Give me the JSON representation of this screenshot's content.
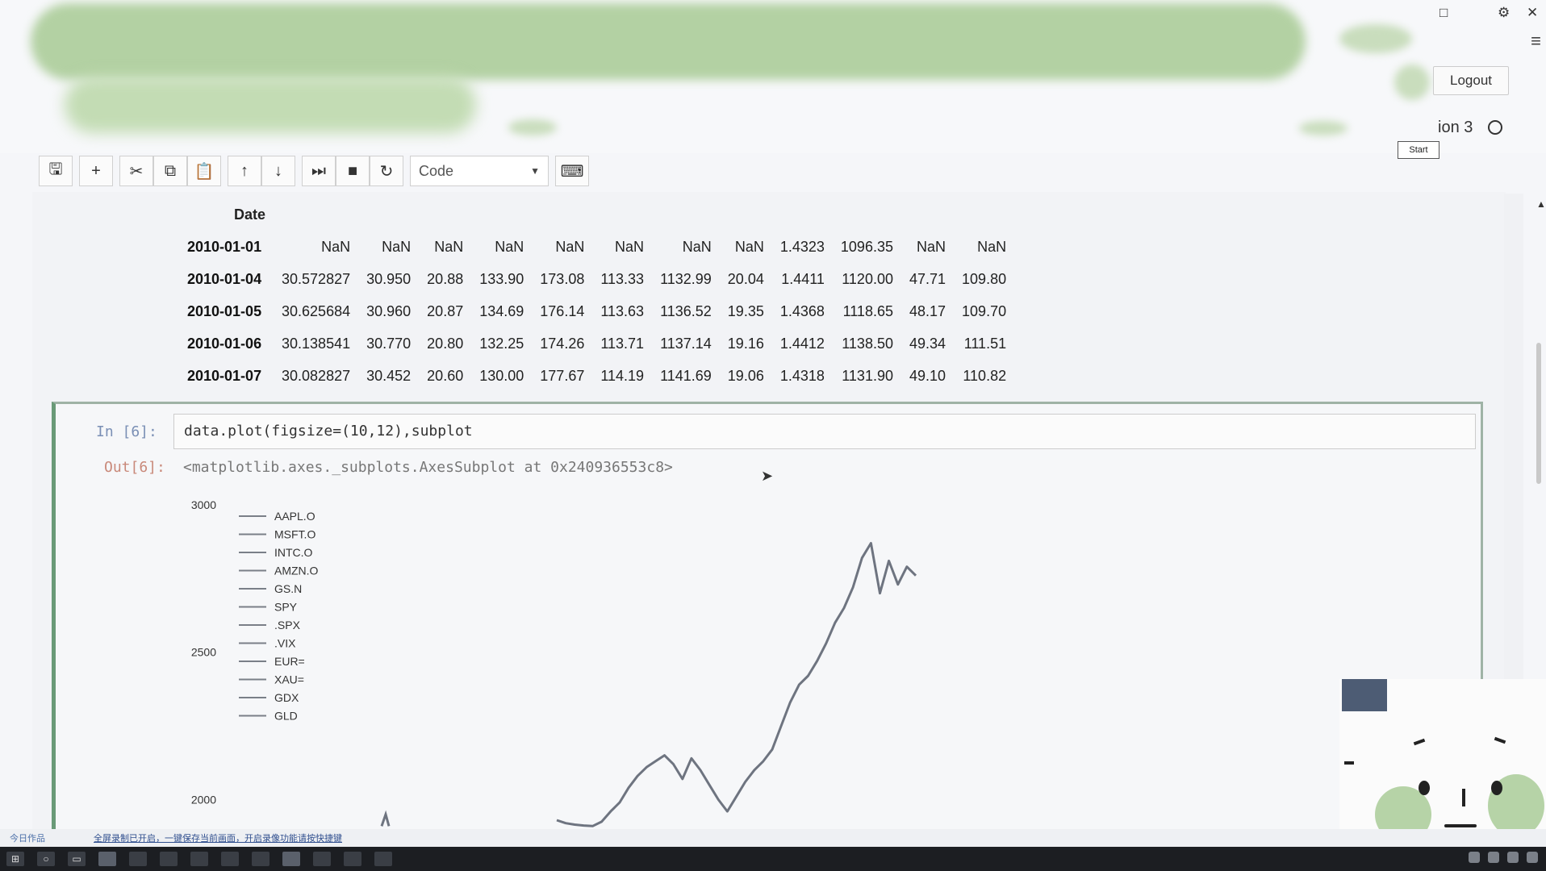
{
  "header": {
    "logout_label": "Logout",
    "kernel_name": "ion 3",
    "start_tip": "Start",
    "window_controls": [
      "□",
      "⚙",
      "✕"
    ],
    "menu_icon": "≡"
  },
  "toolbar": {
    "save": "🖫",
    "add": "+",
    "cut": "✂",
    "copy": "⧉",
    "paste": "📋",
    "move_up": "↑",
    "move_down": "↓",
    "run": "⏭",
    "stop": "■",
    "restart": "↻",
    "cell_type": "Code",
    "keyboard": "⌨"
  },
  "dataframe": {
    "index_name": "Date",
    "rows": [
      {
        "date": "2010-01-01",
        "values": [
          "NaN",
          "NaN",
          "NaN",
          "NaN",
          "NaN",
          "NaN",
          "NaN",
          "NaN",
          "1.4323",
          "1096.35",
          "NaN",
          "NaN"
        ]
      },
      {
        "date": "2010-01-04",
        "values": [
          "30.572827",
          "30.950",
          "20.88",
          "133.90",
          "173.08",
          "113.33",
          "1132.99",
          "20.04",
          "1.4411",
          "1120.00",
          "47.71",
          "109.80"
        ]
      },
      {
        "date": "2010-01-05",
        "values": [
          "30.625684",
          "30.960",
          "20.87",
          "134.69",
          "176.14",
          "113.63",
          "1136.52",
          "19.35",
          "1.4368",
          "1118.65",
          "48.17",
          "109.70"
        ]
      },
      {
        "date": "2010-01-06",
        "values": [
          "30.138541",
          "30.770",
          "20.80",
          "132.25",
          "174.26",
          "113.71",
          "1137.14",
          "19.16",
          "1.4412",
          "1138.50",
          "49.34",
          "111.51"
        ]
      },
      {
        "date": "2010-01-07",
        "values": [
          "30.082827",
          "30.452",
          "20.60",
          "130.00",
          "177.67",
          "114.19",
          "1141.69",
          "19.06",
          "1.4318",
          "1131.90",
          "49.10",
          "110.82"
        ]
      }
    ]
  },
  "cell": {
    "in_prompt": "In  [6]:",
    "code": "data.plot(figsize=(10,12),subplot",
    "out_prompt": "Out[6]:",
    "output": "<matplotlib.axes._subplots.AxesSubplot at 0x240936553c8>"
  },
  "chart_data": {
    "type": "line",
    "yticks": [
      "3000",
      "2500",
      "2000"
    ],
    "ylim": [
      1900,
      3000
    ],
    "legend_position": "top-left",
    "series": [
      {
        "name": "AAPL.O"
      },
      {
        "name": "MSFT.O"
      },
      {
        "name": "INTC.O"
      },
      {
        "name": "AMZN.O"
      },
      {
        "name": "GS.N"
      },
      {
        "name": "SPY"
      },
      {
        "name": ".SPX"
      },
      {
        "name": ".VIX"
      },
      {
        "name": "EUR="
      },
      {
        "name": "XAU="
      },
      {
        "name": "GDX"
      },
      {
        "name": "GLD"
      }
    ],
    "visible_series_values": [
      1930,
      1920,
      1915,
      1912,
      1910,
      1925,
      1960,
      1990,
      2040,
      2080,
      2110,
      2130,
      2150,
      2120,
      2070,
      2140,
      2100,
      2050,
      2000,
      1960,
      2010,
      2060,
      2100,
      2130,
      2170,
      2250,
      2330,
      2390,
      2420,
      2470,
      2530,
      2600,
      2650,
      2720,
      2820,
      2870,
      2700,
      2810,
      2730,
      2790,
      2760
    ]
  },
  "status": {
    "left": "今日作品",
    "middle": "全屏录制已开启，一键保存当前画面，开启录像功能请按快捷键"
  },
  "colors": {
    "accent_green": "#b3d1a3",
    "line_gray": "#6e7480",
    "cell_border": "#6a9a78"
  }
}
